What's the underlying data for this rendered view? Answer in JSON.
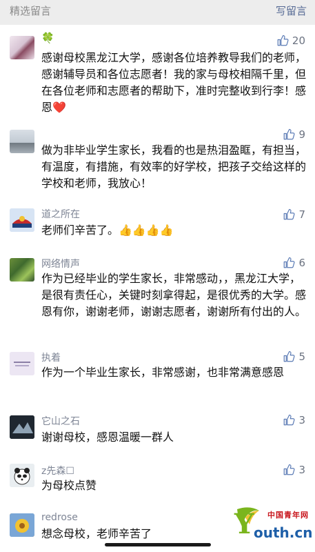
{
  "header": {
    "title": "精选留言",
    "action": "写留言"
  },
  "comments": [
    {
      "nickname": "🍀",
      "likes": "20",
      "text": "感谢母校黑龙江大学，感谢各位培养教导我们的老师，感谢辅导员和各位志愿者！我的家与母校相隔千里，但在各位老师和志愿者的帮助下，准时完整收到行李！感恩❤️"
    },
    {
      "nickname": "",
      "likes": "9",
      "text": "做为非毕业学生家长，我看的也是热泪盈眶，有担当，有温度，有措施，有效率的好学校，把孩子交给这样的学校和老师，我放心！"
    },
    {
      "nickname": "道之所在",
      "likes": "7",
      "text": "老师们辛苦了。👍👍👍👍"
    },
    {
      "nickname": "网络情声",
      "likes": "6",
      "text": "作为已经毕业的学生家长，非常感动，，黑龙江大学，是很有责任心，关键时刻拿得起，是很优秀的大学。感恩有你，谢谢老师，谢谢志愿者，谢谢所有付出的人。"
    },
    {
      "nickname": "执着",
      "likes": "5",
      "text": "作为一个毕业生家长，非常感谢，也非常满意感恩"
    },
    {
      "nickname": "它山之石",
      "likes": "3",
      "text": "谢谢母校，感恩温暖一群人"
    },
    {
      "nickname": "z先森☐",
      "likes": "3",
      "text": "为母校点赞"
    },
    {
      "nickname": "redrose",
      "likes": "",
      "text": "想念母校，老师辛苦了"
    }
  ],
  "watermark": {
    "letter": "Y",
    "url": "outh.cn",
    "tag": "中国青年网"
  },
  "icons": {
    "like": "thumbs-up-icon"
  },
  "colors": {
    "link": "#576b95",
    "leaf": "#3bb54a"
  }
}
